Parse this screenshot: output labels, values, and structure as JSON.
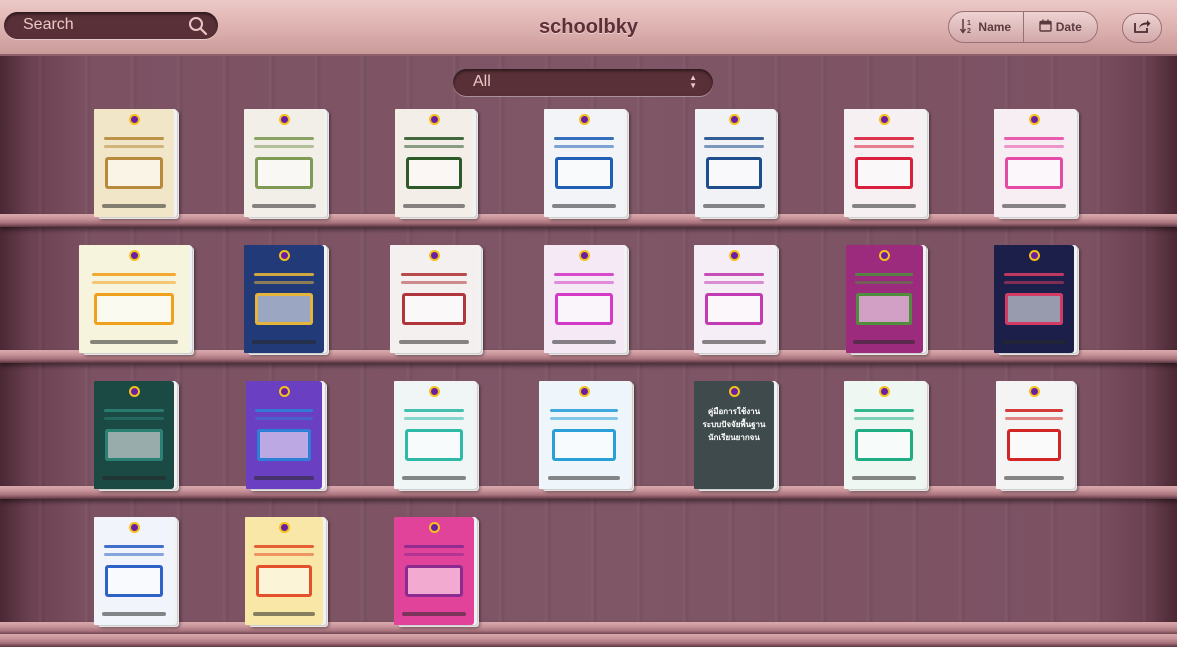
{
  "header": {
    "title": "schoolbky",
    "search_placeholder": "Search",
    "sort_name_label": "Name",
    "sort_date_label": "Date"
  },
  "filter": {
    "selected": "All"
  },
  "icons": {
    "search": "search-icon",
    "sort_name": "sort-alpha-icon",
    "sort_date": "calendar-icon",
    "share": "share-icon",
    "filter_arrows": "chevron-updown-icon"
  },
  "colors": {
    "topbar": "#dcb0ae",
    "title": "#5d2f37",
    "wall": "#7f5666",
    "plank": "#c8949b"
  },
  "shelves": [
    {
      "books": [
        {
          "name": "book-1",
          "main": "#f2e6c8",
          "accent": "#b78a3c"
        },
        {
          "name": "book-2",
          "main": "#f1efe8",
          "accent": "#7e9a55"
        },
        {
          "name": "book-3",
          "main": "#f3eee8",
          "accent": "#2e5a2a"
        },
        {
          "name": "book-4",
          "main": "#f2f4f8",
          "accent": "#1f5fb5"
        },
        {
          "name": "book-5",
          "main": "#f1f2f6",
          "accent": "#1d4d8c"
        },
        {
          "name": "book-6",
          "main": "#f6f0f2",
          "accent": "#d91f3c"
        },
        {
          "name": "book-7",
          "main": "#f7eef4",
          "accent": "#e64aa5"
        }
      ]
    },
    {
      "books": [
        {
          "name": "book-8",
          "main": "#f7f4dd",
          "accent": "#f0a11c"
        },
        {
          "name": "book-9",
          "main": "#233a78",
          "accent": "#e4b43b"
        },
        {
          "name": "book-10",
          "main": "#f3f0ef",
          "accent": "#b1363b"
        },
        {
          "name": "book-11",
          "main": "#f4e9f4",
          "accent": "#d43ac7"
        },
        {
          "name": "book-12",
          "main": "#f6eef6",
          "accent": "#c23bb3"
        },
        {
          "name": "book-13",
          "main": "#9c2b7e",
          "accent": "#4f8d3d"
        },
        {
          "name": "book-14",
          "main": "#1c1f4a",
          "accent": "#d33a64"
        }
      ]
    },
    {
      "books": [
        {
          "name": "book-15",
          "main": "#1b4a45",
          "accent": "#2b7f73"
        },
        {
          "name": "book-16",
          "main": "#6a3fc2",
          "accent": "#2d7fd5"
        },
        {
          "name": "book-17",
          "main": "#f0f6f5",
          "accent": "#2fb9a7"
        },
        {
          "name": "book-18",
          "main": "#eef6fb",
          "accent": "#2ba0d8"
        },
        {
          "name": "book-19",
          "main": "#3e4a4c",
          "accent": "#6c7a7c",
          "title_lines": [
            "คู่มือการใช้งาน",
            "ระบบปัจจัยพื้นฐาน",
            "นักเรียนยากจน"
          ]
        },
        {
          "name": "book-20",
          "main": "#eef7f2",
          "accent": "#1fae84"
        },
        {
          "name": "book-21",
          "main": "#f4f4f4",
          "accent": "#d32525"
        }
      ]
    },
    {
      "books": [
        {
          "name": "book-22",
          "main": "#f1f4fb",
          "accent": "#2e62c6"
        },
        {
          "name": "book-23",
          "main": "#f8e7a6",
          "accent": "#e3502a"
        },
        {
          "name": "book-24",
          "main": "#e2439a",
          "accent": "#8b2a8f"
        }
      ]
    }
  ]
}
